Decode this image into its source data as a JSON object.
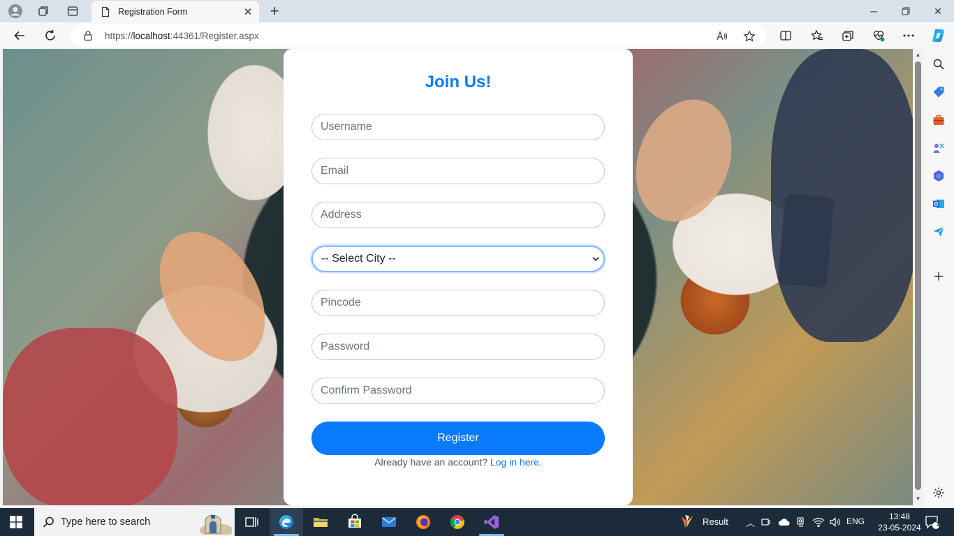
{
  "browser": {
    "tab_title": "Registration Form",
    "url_prefix": "https://",
    "url_host": "localhost",
    "url_rest": ":44361/Register.aspx"
  },
  "form": {
    "heading": "Join Us!",
    "username_placeholder": "Username",
    "email_placeholder": "Email",
    "address_placeholder": "Address",
    "city_selected": "-- Select City --",
    "pincode_placeholder": "Pincode",
    "password_placeholder": "Password",
    "confirm_password_placeholder": "Confirm Password",
    "register_label": "Register",
    "login_prompt": "Already have an account?",
    "login_link": "Log in here."
  },
  "taskbar": {
    "search_placeholder": "Type here to search",
    "result_label": "Result",
    "language": "ENG",
    "time": "13:48",
    "date": "23-05-2024",
    "notification_count": "1"
  },
  "colors": {
    "accent": "#0a7bfe",
    "heading": "#0a7bf5",
    "taskbar": "#1c2b3a"
  }
}
